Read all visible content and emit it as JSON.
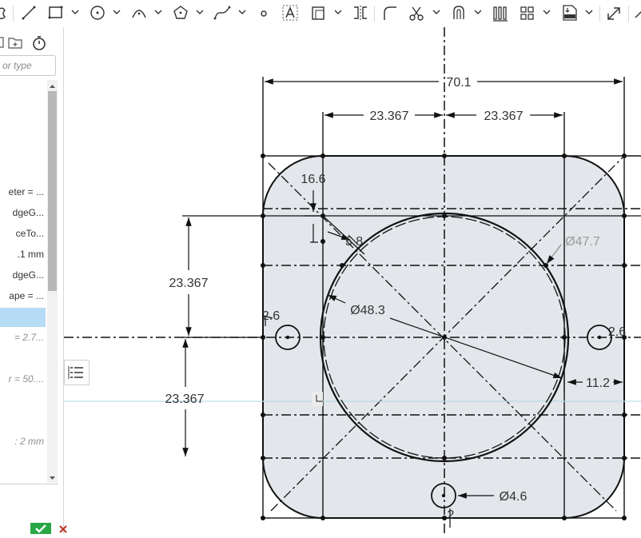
{
  "toolbar": {
    "tools": [
      "construction-icon",
      "line-icon",
      "rectangle-icon",
      "circle-icon",
      "arc-icon",
      "polygon-icon",
      "spline-icon",
      "point-icon",
      "text-icon",
      "offset-icon",
      "mirror-icon",
      "fillet-icon",
      "trim-icon",
      "extend-icon",
      "pattern-icon",
      "grid-pattern-icon",
      "dxf-icon",
      "transform-icon"
    ]
  },
  "panel": {
    "search_placeholder": "or type",
    "items": [
      {
        "label": "eter = ...",
        "style": "normal"
      },
      {
        "label": "dgeG...",
        "style": "normal"
      },
      {
        "label": "ceTo...",
        "style": "normal"
      },
      {
        "label": ".1 mm",
        "style": "normal"
      },
      {
        "label": "dgeG...",
        "style": "normal"
      },
      {
        "label": "ape = ...",
        "style": "normal"
      },
      {
        "label": "",
        "style": "selected"
      },
      {
        "label": "= 2.7...",
        "style": "grey"
      },
      {
        "label": "r = 50....",
        "style": "grey"
      },
      {
        "label": "",
        "style": "grey"
      },
      {
        "label": ": 2 mm",
        "style": "grey"
      }
    ]
  },
  "sketch": {
    "dimensions": {
      "overall_width": "70.1",
      "left_half": "23.367",
      "right_half": "23.367",
      "upper_height": "23.367",
      "lower_height": "23.367",
      "corner": "16.6",
      "chamfer": "5.8",
      "outer_diameter": "Ø48.3",
      "inner_diameter": "Ø47.7",
      "offset": "11.2",
      "hole_diameter": "Ø4.6",
      "left_hole": "2.6",
      "right_hole": "2.6",
      "bottom_hole": "2"
    }
  },
  "colors": {
    "plate_fill": "#e3e6ea",
    "selection": "#b6dbf5",
    "ok": "#28a745",
    "cancel": "#c0392b"
  }
}
